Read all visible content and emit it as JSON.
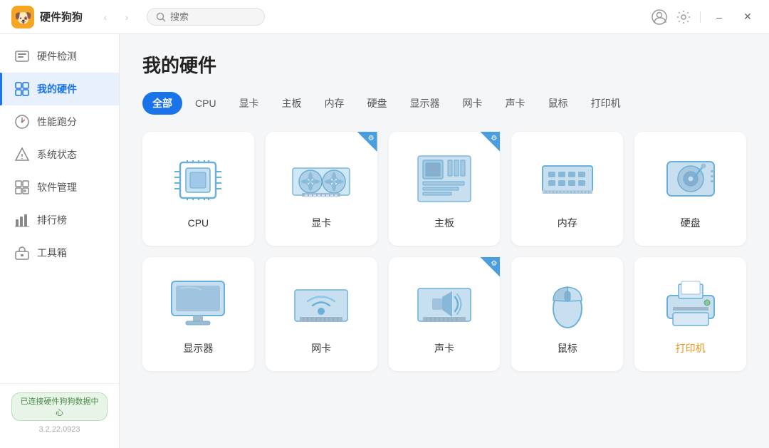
{
  "app": {
    "title": "硬件狗狗",
    "version": "3.2.22.0923",
    "status": "已连接硬件狗狗数据中心",
    "search_placeholder": "搜索"
  },
  "window_controls": {
    "minimize": "—",
    "close": "✕"
  },
  "sidebar": {
    "items": [
      {
        "id": "hardware-check",
        "label": "硬件检测",
        "active": false
      },
      {
        "id": "my-hardware",
        "label": "我的硬件",
        "active": true
      },
      {
        "id": "benchmark",
        "label": "性能跑分",
        "active": false
      },
      {
        "id": "system-status",
        "label": "系统状态",
        "active": false
      },
      {
        "id": "software-mgmt",
        "label": "软件管理",
        "active": false
      },
      {
        "id": "ranking",
        "label": "排行榜",
        "active": false
      },
      {
        "id": "toolbox",
        "label": "工具箱",
        "active": false
      }
    ]
  },
  "page": {
    "title": "我的硬件"
  },
  "categories": {
    "tabs": [
      {
        "id": "all",
        "label": "全部",
        "active": true
      },
      {
        "id": "cpu",
        "label": "CPU",
        "active": false
      },
      {
        "id": "gpu",
        "label": "显卡",
        "active": false
      },
      {
        "id": "motherboard",
        "label": "主板",
        "active": false
      },
      {
        "id": "memory",
        "label": "内存",
        "active": false
      },
      {
        "id": "disk",
        "label": "硬盘",
        "active": false
      },
      {
        "id": "monitor",
        "label": "显示器",
        "active": false
      },
      {
        "id": "nic",
        "label": "网卡",
        "active": false
      },
      {
        "id": "sound",
        "label": "声卡",
        "active": false
      },
      {
        "id": "mouse",
        "label": "鼠标",
        "active": false
      },
      {
        "id": "printer",
        "label": "打印机",
        "active": false
      }
    ]
  },
  "hardware_items": [
    {
      "id": "cpu",
      "label": "CPU",
      "has_badge": false,
      "highlight": false
    },
    {
      "id": "gpu",
      "label": "显卡",
      "has_badge": true,
      "highlight": false
    },
    {
      "id": "motherboard",
      "label": "主板",
      "has_badge": true,
      "highlight": false
    },
    {
      "id": "memory",
      "label": "内存",
      "has_badge": false,
      "highlight": false
    },
    {
      "id": "disk",
      "label": "硬盘",
      "has_badge": false,
      "highlight": false
    },
    {
      "id": "monitor",
      "label": "显示器",
      "has_badge": false,
      "highlight": false
    },
    {
      "id": "nic",
      "label": "网卡",
      "has_badge": false,
      "highlight": false
    },
    {
      "id": "sound",
      "label": "声卡",
      "has_badge": true,
      "highlight": false
    },
    {
      "id": "mouse",
      "label": "鼠标",
      "has_badge": false,
      "highlight": false
    },
    {
      "id": "printer",
      "label": "打印机",
      "has_badge": false,
      "highlight": true
    }
  ]
}
